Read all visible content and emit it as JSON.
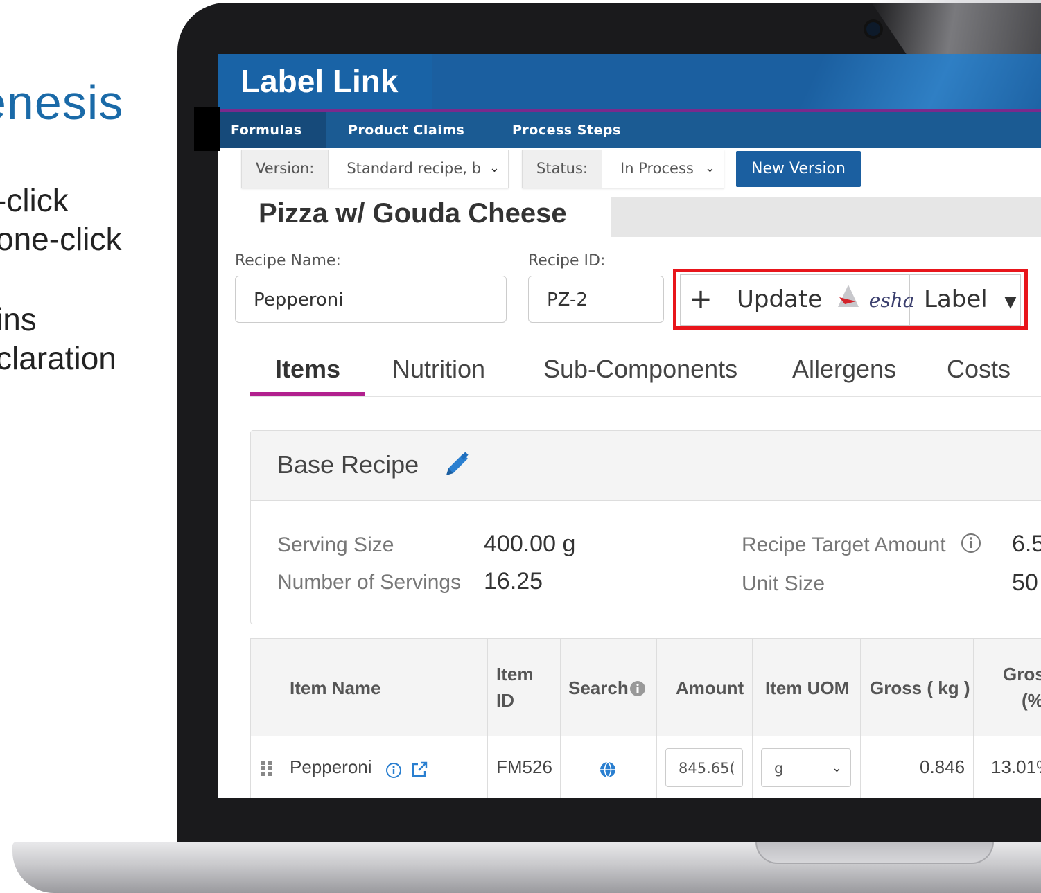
{
  "slide": {
    "title_fragment": "enesis",
    "lines": [
      "-click",
      "one-click",
      "ins",
      "claration"
    ]
  },
  "app": {
    "brand": "Label Link",
    "nav": [
      "Formulas",
      "Product Claims",
      "Process Steps"
    ]
  },
  "version_row": {
    "version_label": "Version:",
    "version_value": "Standard recipe, b",
    "status_label": "Status:",
    "status_value": "In Process",
    "new_version_button": "New Version"
  },
  "recipe": {
    "title": "Pizza w/ Gouda Cheese",
    "name_label": "Recipe Name:",
    "name_value": "Pepperoni",
    "id_label": "Recipe ID:",
    "id_value": "PZ-2"
  },
  "actions": {
    "plus": "+",
    "update": "Update",
    "esha": "esha",
    "label": "Label"
  },
  "tabs": [
    "Items",
    "Nutrition",
    "Sub-Components",
    "Allergens",
    "Costs"
  ],
  "base_recipe": {
    "title": "Base Recipe",
    "serving_size_label": "Serving Size",
    "serving_size_value": "400.00 g",
    "servings_label": "Number of Servings",
    "servings_value": "16.25",
    "target_label": "Recipe Target Amount",
    "target_value": "6.5",
    "unit_size_label": "Unit Size",
    "unit_size_value": "50"
  },
  "table": {
    "headers": {
      "item_name": "Item Name",
      "item_id_1": "Item",
      "item_id_2": "ID",
      "search": "Search",
      "amount": "Amount",
      "uom": "Item UOM",
      "gross": "Gross ( kg )",
      "gross_pct_1": "Gros",
      "gross_pct_2": "(%"
    },
    "rows": [
      {
        "name": "Pepperoni",
        "id": "FM526",
        "amount": "845.65(",
        "uom": "g",
        "gross": "0.846",
        "gross_pct": "13.01%"
      }
    ]
  },
  "colors": {
    "brand_blue": "#1b5fa0",
    "accent_magenta": "#b1208e",
    "highlight_red": "#e8151b"
  }
}
